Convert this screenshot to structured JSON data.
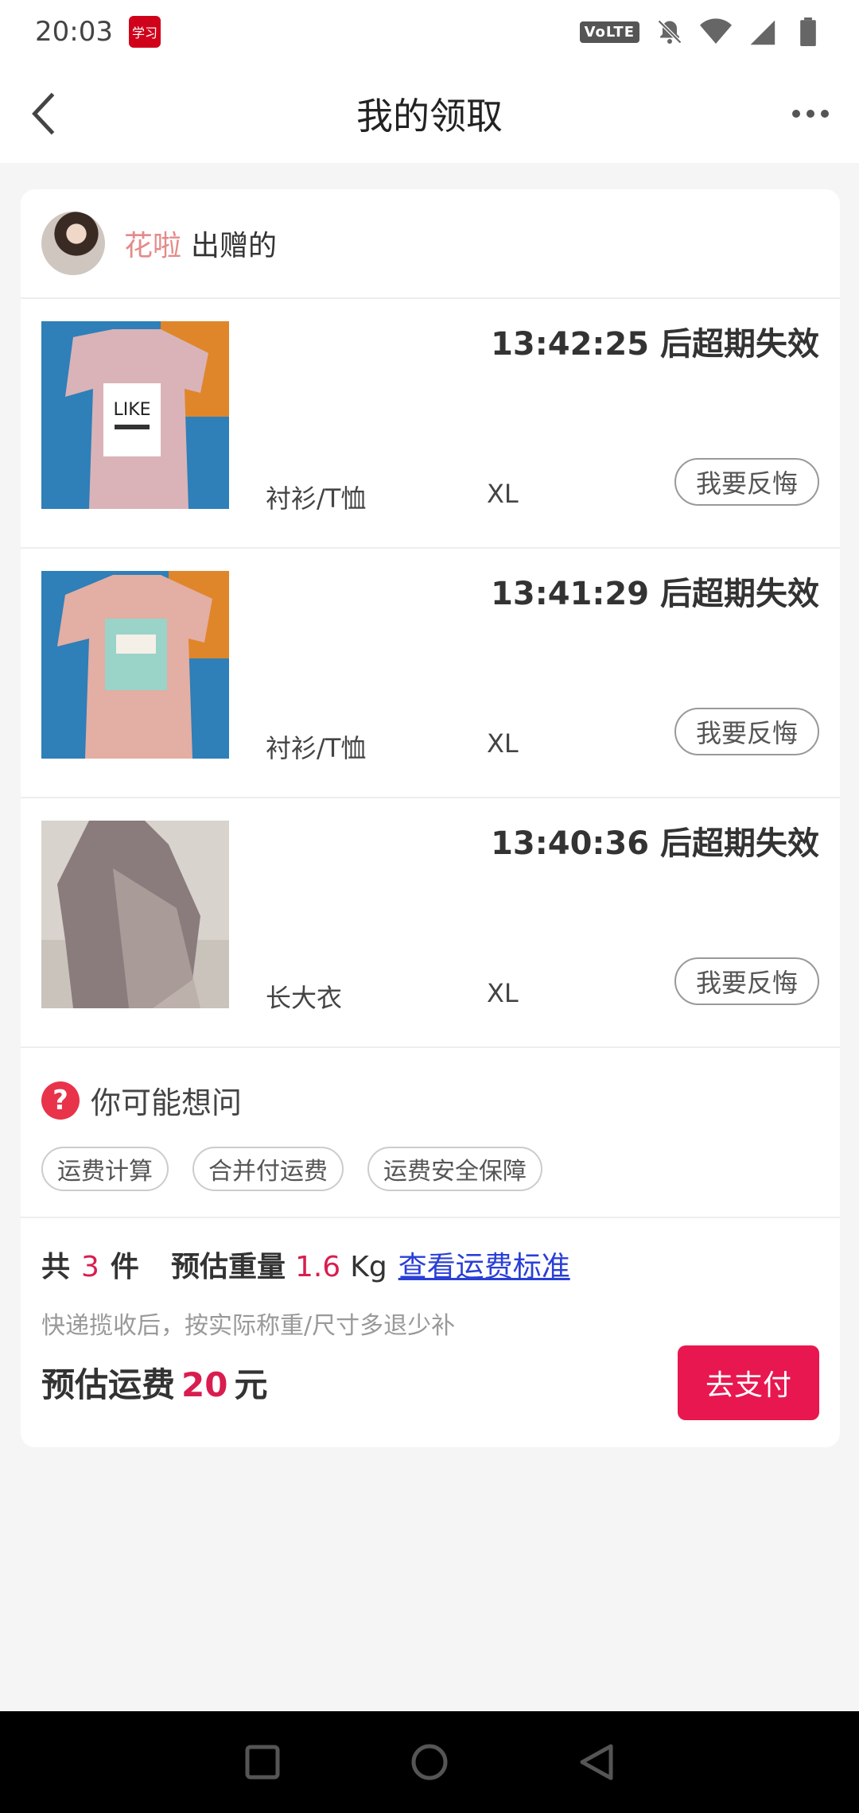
{
  "status_bar": {
    "time": "20:03",
    "app_badge": "学习",
    "volte": "VoLTE"
  },
  "nav": {
    "title": "我的领取"
  },
  "donor": {
    "name": "花啦",
    "suffix": "出赠的"
  },
  "items": [
    {
      "countdown": "13:42:25 后超期失效",
      "category": "衬衫/T恤",
      "size": "XL",
      "button": "我要反悔"
    },
    {
      "countdown": "13:41:29 后超期失效",
      "category": "衬衫/T恤",
      "size": "XL",
      "button": "我要反悔"
    },
    {
      "countdown": "13:40:36 后超期失效",
      "category": "长大衣",
      "size": "XL",
      "button": "我要反悔"
    }
  ],
  "faq": {
    "title": "你可能想问",
    "tags": [
      "运费计算",
      "合并付运费",
      "运费安全保障"
    ]
  },
  "summary": {
    "total_prefix": "共",
    "total_count": "3",
    "total_suffix": "件",
    "weight_label": "预估重量",
    "weight_value": "1.6",
    "weight_unit": "Kg",
    "fee_link": "查看运费标准",
    "note": "快递揽收后，按实际称重/尺寸多退少补",
    "fee_label": "预估运费",
    "fee_value": "20",
    "fee_unit": "元",
    "pay_button": "去支付"
  },
  "colors": {
    "accent": "#e8174f",
    "price": "#d81e4f",
    "donor_name": "#e58a8a",
    "link": "#2a3fd6"
  }
}
